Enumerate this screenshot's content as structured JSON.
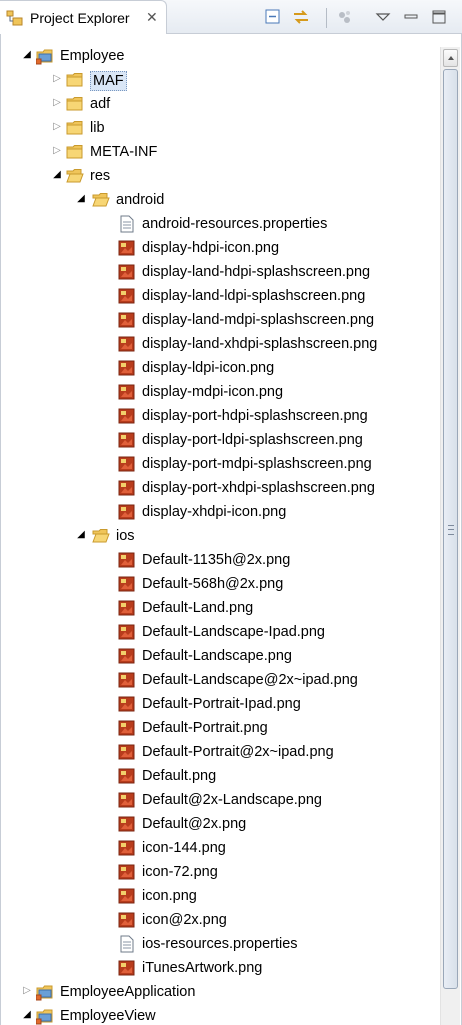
{
  "view": {
    "title": "Project Explorer",
    "close_glyph": "✕",
    "toolbar": [
      "collapse-all-icon",
      "link-with-editor-icon",
      "filters-icon",
      "view-menu-icon",
      "minimize-icon",
      "maximize-icon"
    ]
  },
  "colors": {
    "folder": "#f0c55a",
    "folder_dark": "#c99a2d",
    "project": "#6a9fd6",
    "png": "#b83c1c",
    "selection": "#d9e6f6"
  },
  "tree": [
    {
      "label": "Employee",
      "depth": 0,
      "state": "open",
      "icon": "project-icon"
    },
    {
      "label": "MAF",
      "depth": 1,
      "state": "closed",
      "icon": "folder-icon"
    },
    {
      "label": "adf",
      "depth": 1,
      "state": "closed",
      "icon": "folder-icon"
    },
    {
      "label": "lib",
      "depth": 1,
      "state": "closed",
      "icon": "folder-icon"
    },
    {
      "label": "META-INF",
      "depth": 1,
      "state": "closed",
      "icon": "folder-icon"
    },
    {
      "label": "res",
      "depth": 1,
      "state": "open",
      "icon": "folder-open-icon"
    },
    {
      "label": "android",
      "depth": 2,
      "state": "open",
      "icon": "folder-open-icon"
    },
    {
      "label": "android-resources.properties",
      "depth": 3,
      "state": "leaf",
      "icon": "properties-file-icon"
    },
    {
      "label": "display-hdpi-icon.png",
      "depth": 3,
      "state": "leaf",
      "icon": "png-file-icon"
    },
    {
      "label": "display-land-hdpi-splashscreen.png",
      "depth": 3,
      "state": "leaf",
      "icon": "png-file-icon"
    },
    {
      "label": "display-land-ldpi-splashscreen.png",
      "depth": 3,
      "state": "leaf",
      "icon": "png-file-icon"
    },
    {
      "label": "display-land-mdpi-splashscreen.png",
      "depth": 3,
      "state": "leaf",
      "icon": "png-file-icon"
    },
    {
      "label": "display-land-xhdpi-splashscreen.png",
      "depth": 3,
      "state": "leaf",
      "icon": "png-file-icon"
    },
    {
      "label": "display-ldpi-icon.png",
      "depth": 3,
      "state": "leaf",
      "icon": "png-file-icon"
    },
    {
      "label": "display-mdpi-icon.png",
      "depth": 3,
      "state": "leaf",
      "icon": "png-file-icon"
    },
    {
      "label": "display-port-hdpi-splashscreen.png",
      "depth": 3,
      "state": "leaf",
      "icon": "png-file-icon"
    },
    {
      "label": "display-port-ldpi-splashscreen.png",
      "depth": 3,
      "state": "leaf",
      "icon": "png-file-icon"
    },
    {
      "label": "display-port-mdpi-splashscreen.png",
      "depth": 3,
      "state": "leaf",
      "icon": "png-file-icon"
    },
    {
      "label": "display-port-xhdpi-splashscreen.png",
      "depth": 3,
      "state": "leaf",
      "icon": "png-file-icon"
    },
    {
      "label": "display-xhdpi-icon.png",
      "depth": 3,
      "state": "leaf",
      "icon": "png-file-icon"
    },
    {
      "label": "ios",
      "depth": 2,
      "state": "open",
      "icon": "folder-open-icon"
    },
    {
      "label": "Default-1135h@2x.png",
      "depth": 3,
      "state": "leaf",
      "icon": "png-file-icon"
    },
    {
      "label": "Default-568h@2x.png",
      "depth": 3,
      "state": "leaf",
      "icon": "png-file-icon"
    },
    {
      "label": "Default-Land.png",
      "depth": 3,
      "state": "leaf",
      "icon": "png-file-icon"
    },
    {
      "label": "Default-Landscape-Ipad.png",
      "depth": 3,
      "state": "leaf",
      "icon": "png-file-icon"
    },
    {
      "label": "Default-Landscape.png",
      "depth": 3,
      "state": "leaf",
      "icon": "png-file-icon"
    },
    {
      "label": "Default-Landscape@2x~ipad.png",
      "depth": 3,
      "state": "leaf",
      "icon": "png-file-icon"
    },
    {
      "label": "Default-Portrait-Ipad.png",
      "depth": 3,
      "state": "leaf",
      "icon": "png-file-icon"
    },
    {
      "label": "Default-Portrait.png",
      "depth": 3,
      "state": "leaf",
      "icon": "png-file-icon"
    },
    {
      "label": "Default-Portrait@2x~ipad.png",
      "depth": 3,
      "state": "leaf",
      "icon": "png-file-icon"
    },
    {
      "label": "Default.png",
      "depth": 3,
      "state": "leaf",
      "icon": "png-file-icon"
    },
    {
      "label": "Default@2x-Landscape.png",
      "depth": 3,
      "state": "leaf",
      "icon": "png-file-icon"
    },
    {
      "label": "Default@2x.png",
      "depth": 3,
      "state": "leaf",
      "icon": "png-file-icon"
    },
    {
      "label": "icon-144.png",
      "depth": 3,
      "state": "leaf",
      "icon": "png-file-icon"
    },
    {
      "label": "icon-72.png",
      "depth": 3,
      "state": "leaf",
      "icon": "png-file-icon"
    },
    {
      "label": "icon.png",
      "depth": 3,
      "state": "leaf",
      "icon": "png-file-icon"
    },
    {
      "label": "icon@2x.png",
      "depth": 3,
      "state": "leaf",
      "icon": "png-file-icon"
    },
    {
      "label": "ios-resources.properties",
      "depth": 3,
      "state": "leaf",
      "icon": "properties-file-icon"
    },
    {
      "label": "iTunesArtwork.png",
      "depth": 3,
      "state": "leaf",
      "icon": "png-file-icon"
    },
    {
      "label": "EmployeeApplication",
      "depth": 0,
      "state": "closed",
      "icon": "project-icon"
    },
    {
      "label": "EmployeeView",
      "depth": 0,
      "state": "open",
      "icon": "project-icon"
    }
  ]
}
